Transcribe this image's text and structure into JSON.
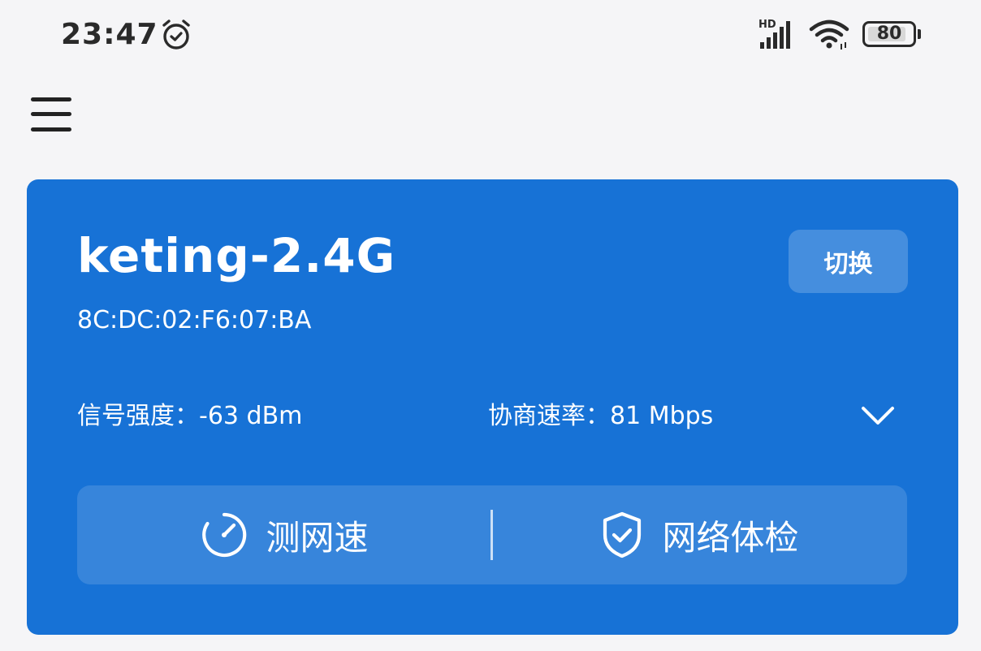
{
  "status_bar": {
    "time": "23:47",
    "network_label": "HD",
    "battery": "80",
    "battery_level": 0.8,
    "icons": [
      "alarm-icon",
      "signal-icon",
      "wifi-icon",
      "battery-icon"
    ]
  },
  "header": {
    "menu_icon": "menu-icon"
  },
  "wifi_card": {
    "ssid": "keting-2.4G",
    "mac": "8C:DC:02:F6:07:BA",
    "switch_label": "切换",
    "signal_strength": "信号强度：-63 dBm",
    "negotiated_rate": "协商速率：81 Mbps",
    "expand_icon": "chevron-down-icon",
    "actions": [
      {
        "label": "测网速",
        "icon": "speedometer-icon"
      },
      {
        "label": "网络体检",
        "icon": "shield-check-icon"
      }
    ]
  },
  "colors": {
    "card_blue": "#1772d6",
    "background": "#f5f5f7",
    "text_dark": "#2a2a2a"
  }
}
